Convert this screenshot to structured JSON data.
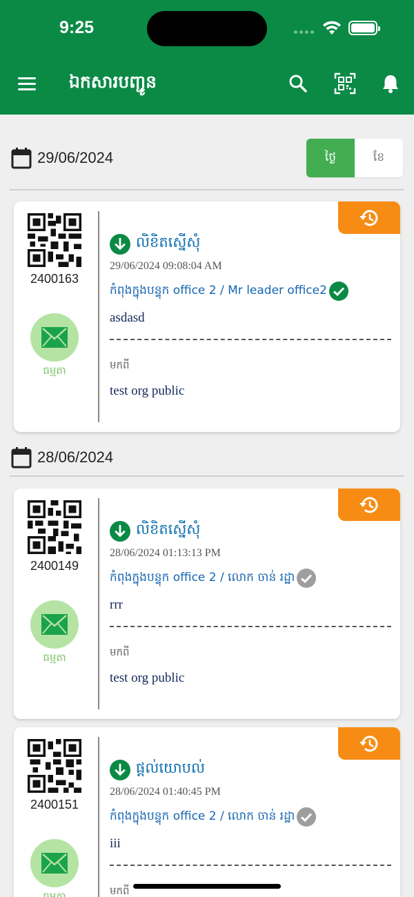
{
  "status_bar": {
    "time": "9:25"
  },
  "app_bar": {
    "title": "ឯកសារបញ្ជូន"
  },
  "view_toggle": {
    "day_label": "ថ្ងៃ",
    "month_label": "ខែ"
  },
  "colors": {
    "primary": "#0a8a45",
    "accent_orange": "#f78c14",
    "toggle_active": "#43ad52",
    "mail_circle": "#b5e3a4",
    "link_blue": "#1565b0"
  },
  "groups": [
    {
      "date": "29/06/2024",
      "cards": [
        {
          "doc_no": "2400163",
          "priority_label": "ធម្មតា",
          "type": "លិខិតស្នើសុំ",
          "timestamp": "29/06/2024 09:08:04 AM",
          "location": "កំពុងក្នុងបន្ទុក office 2 / Mr leader office2",
          "status_icon": "check-green",
          "subject": "asdasd",
          "from_label": "មកពី",
          "from_value": "test org public"
        }
      ]
    },
    {
      "date": "28/06/2024",
      "cards": [
        {
          "doc_no": "2400149",
          "priority_label": "ធម្មតា",
          "type": "លិខិតស្នើសុំ",
          "timestamp": "28/06/2024 01:13:13 PM",
          "location": "កំពុងក្នុងបន្ទុក office 2 / លោក ចាន់ រដ្ឋា",
          "status_icon": "check-gray",
          "subject": "rrr",
          "from_label": "មកពី",
          "from_value": "test org public"
        },
        {
          "doc_no": "2400151",
          "priority_label": "ធម្មតា",
          "type": "ផ្តល់យោបល់",
          "timestamp": "28/06/2024 01:40:45 PM",
          "location": "កំពុងក្នុងបន្ទុក office 2 / លោក ចាន់ រដ្ឋា",
          "status_icon": "check-gray",
          "subject": "iii",
          "from_label": "មកពី",
          "from_value": ""
        }
      ]
    }
  ]
}
